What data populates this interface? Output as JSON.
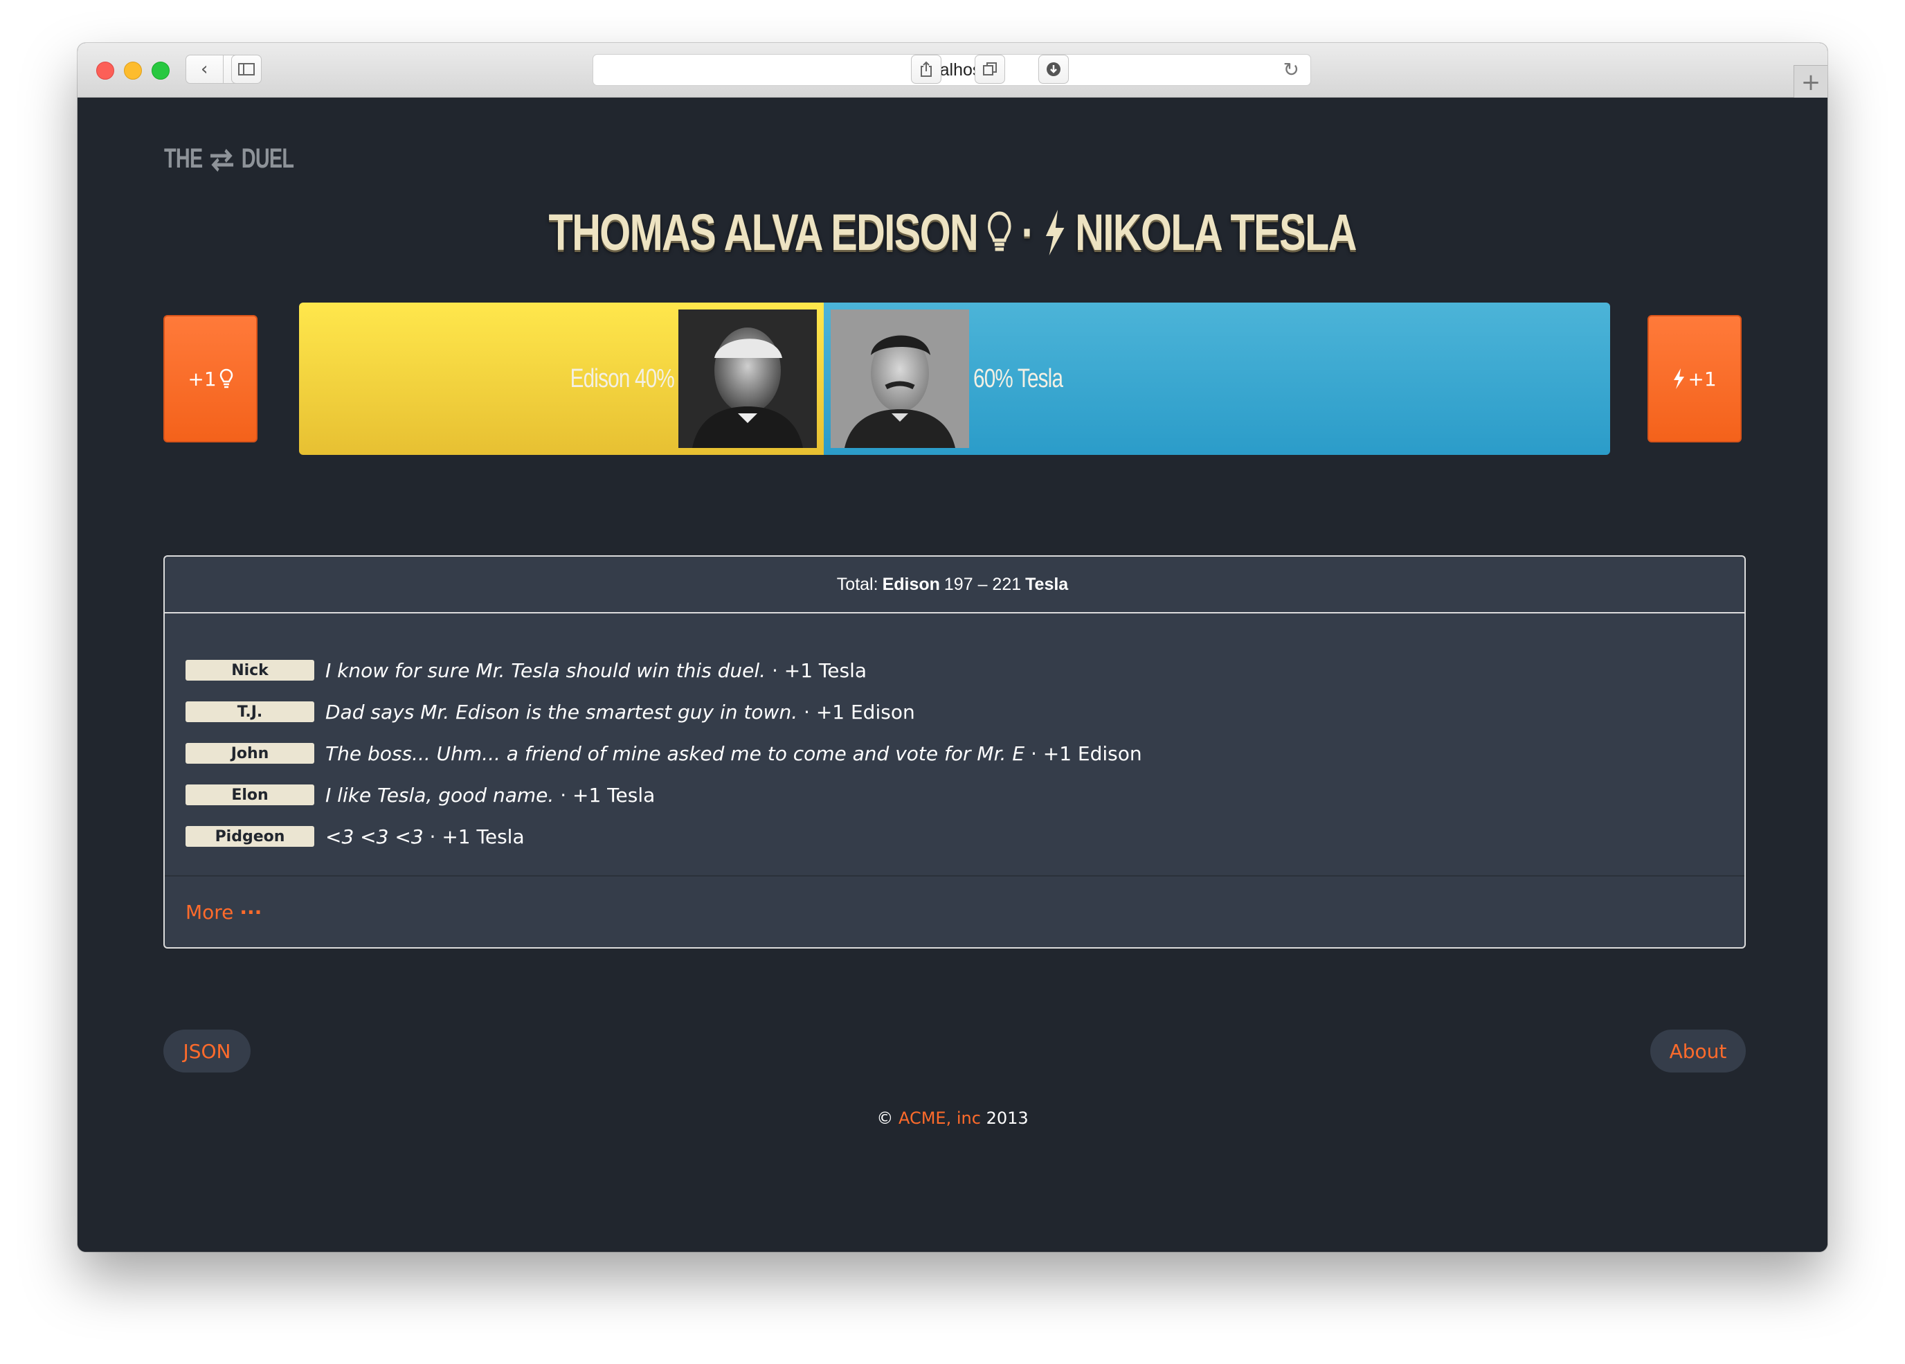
{
  "browser": {
    "url": "localhost"
  },
  "app": {
    "logo_left": "THE",
    "logo_right": "DUEL"
  },
  "duel": {
    "left_name": "THOMAS ALVA EDISON",
    "separator": "·",
    "right_name": "NIKOLA TESLA",
    "vote_left_label": "+1",
    "vote_right_label": "+1",
    "left_label": "Edison 40%",
    "right_label": "60% Tesla",
    "left_share": 0.4,
    "right_share": 0.6,
    "left_color": "#f5d43d",
    "right_color": "#3aa8d2"
  },
  "totals": {
    "prefix": "Total:",
    "left_name": "Edison",
    "score": "197 – 221",
    "right_name": "Tesla"
  },
  "comments": [
    {
      "name": "Nick",
      "text": "I know for sure Mr. Tesla should win this duel.",
      "vote": "· +1 Tesla"
    },
    {
      "name": "T.J.",
      "text": "Dad says Mr. Edison is the smartest guy in town.",
      "vote": "· +1 Edison"
    },
    {
      "name": "John",
      "text": "The boss... Uhm... a friend of mine asked me to come and vote for Mr. E",
      "vote": "· +1 Edison"
    },
    {
      "name": "Elon",
      "text": "I like Tesla, good name.",
      "vote": "· +1 Tesla"
    },
    {
      "name": "Pidgeon",
      "text": "<3 <3 <3",
      "vote": "· +1 Tesla"
    }
  ],
  "more_label": "More",
  "footer": {
    "json_label": "JSON",
    "about_label": "About",
    "copyright_prefix": "©",
    "company": "ACME, inc",
    "year": "2013"
  },
  "colors": {
    "accent": "#ff6b2b",
    "background": "#21262e",
    "panel": "#353d4a"
  }
}
